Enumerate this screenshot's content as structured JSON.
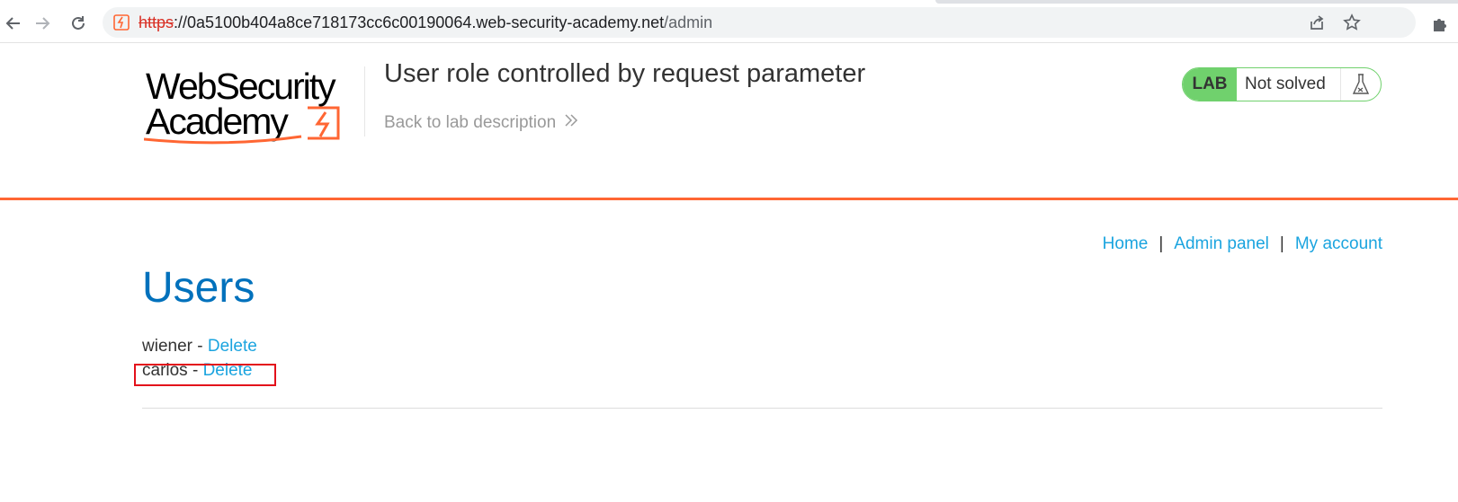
{
  "browser": {
    "url_scheme": "https",
    "url_host": "://0a5100b404a8ce718173cc6c00190064.web-security-academy.net",
    "url_path": "/admin",
    "icons": [
      "back-arrow-icon",
      "forward-arrow-icon",
      "reload-icon",
      "site-lightning-icon",
      "share-icon",
      "bookmark-star-icon",
      "extensions-puzzle-icon"
    ]
  },
  "header": {
    "logo_line1": "WebSecurity",
    "logo_line2": "Academy",
    "lab_title": "User role controlled by request parameter",
    "back_link": "Back to lab description",
    "back_arrow": "»",
    "badge_label": "LAB",
    "badge_status": "Not solved"
  },
  "nav": {
    "home": "Home",
    "admin_panel": "Admin panel",
    "my_account": "My account",
    "separator": "|"
  },
  "main": {
    "heading": "Users",
    "users": [
      {
        "name": "wiener",
        "separator": " - ",
        "action": "Delete"
      },
      {
        "name": "carlos",
        "separator": " - ",
        "action": "Delete"
      }
    ]
  },
  "colors": {
    "accent_orange": "#ff6633",
    "link_blue": "#1ba4df",
    "heading_blue": "#0071bc",
    "lab_green": "#70d16d",
    "highlight_red": "#e3111b"
  }
}
